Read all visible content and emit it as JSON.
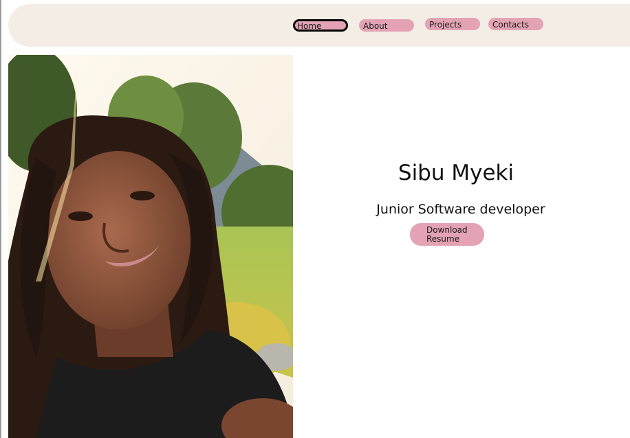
{
  "nav": {
    "items": [
      {
        "label": "Home",
        "active": true
      },
      {
        "label": "About",
        "active": false
      },
      {
        "label": "Projects",
        "active": false
      },
      {
        "label": "Contacts",
        "active": false
      }
    ]
  },
  "hero": {
    "name": "Sibu Myeki",
    "role": "Junior Software developer",
    "resume_label": "Download Resume",
    "photo_subject": "profile-photo"
  },
  "colors": {
    "nav_background": "#f3ede6",
    "button_pink": "#e3a3b4",
    "text": "#111111"
  }
}
